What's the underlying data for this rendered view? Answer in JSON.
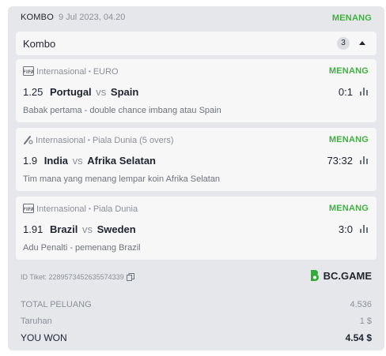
{
  "header": {
    "type": "KOMBO",
    "date": "9 Jul 2023, 04.20",
    "status": "MENANG"
  },
  "combo": {
    "label": "Kombo",
    "count": "3"
  },
  "bets": [
    {
      "region": "Internasional",
      "competition": "EURO",
      "status": "MENANG",
      "odds": "1.25",
      "home": "Portugal",
      "vs": "vs",
      "away": "Spain",
      "score": "0:1",
      "pick": "Babak pertama - double chance imbang atau Spain",
      "icon": "fifa-game-icon"
    },
    {
      "region": "Internasional",
      "competition": "Piala Dunia (5 overs)",
      "status": "MENANG",
      "odds": "1.9",
      "home": "India",
      "vs": "vs",
      "away": "Afrika Selatan",
      "score": "73:32",
      "pick": "Tim mana yang menang lempar koin Afrika Selatan",
      "icon": "cricket-icon"
    },
    {
      "region": "Internasional",
      "competition": "Piala Dunia",
      "status": "MENANG",
      "odds": "1.91",
      "home": "Brazil",
      "vs": "vs",
      "away": "Sweden",
      "score": "3:0",
      "pick": "Adu Penalti - pemenang Brazil",
      "icon": "fifa-penalty-icon"
    }
  ],
  "footer": {
    "ticket_id": "ID Tiket: 2289573452635574339",
    "brand": "BC.GAME",
    "total_odds_label": "TOTAL PELUANG",
    "total_odds": "4.536",
    "stake_label": "Taruhan",
    "stake": "1 $",
    "won_label": "YOU WON",
    "won": "4.54 $"
  },
  "colors": {
    "win": "#3fb13f",
    "panel": "#e6e7ea",
    "card": "#f7f7f8"
  }
}
